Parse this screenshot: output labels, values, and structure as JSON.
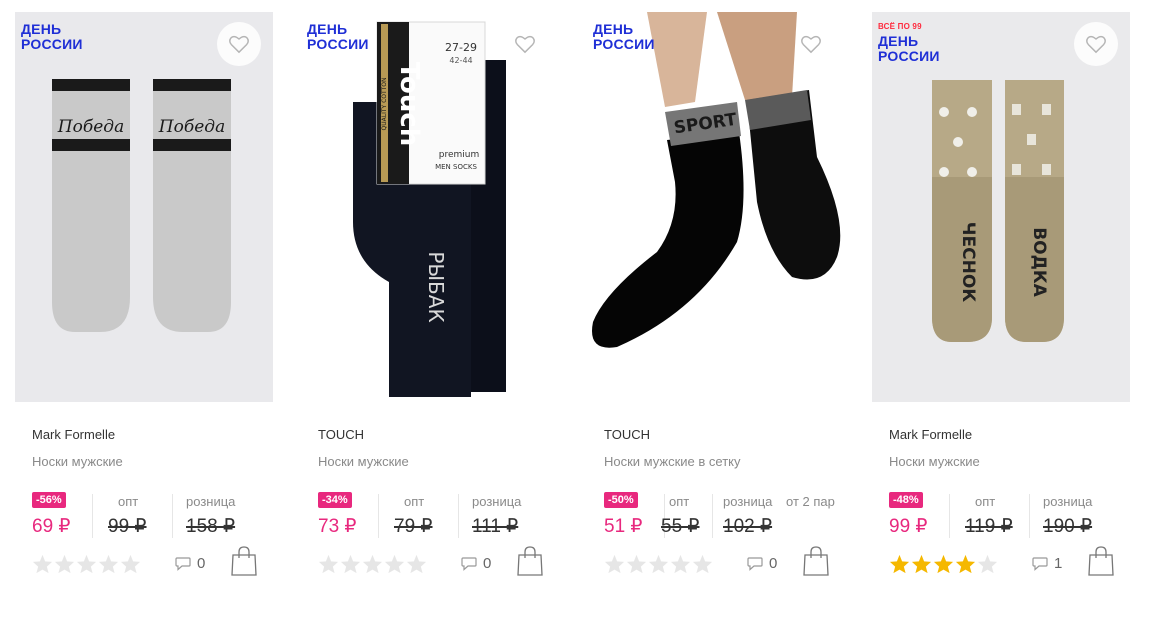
{
  "products": [
    {
      "promo_small": "",
      "promo_line1": "ДЕНЬ",
      "promo_line2": "РОССИИ",
      "brand": "Mark Formelle",
      "title": "Носки мужские",
      "discount": "-56%",
      "price": "69 ₽",
      "label_opt": "опт",
      "opt_price": "99 ₽",
      "label_retail": "розница",
      "retail_price": "158 ₽",
      "label_extra": "",
      "rating": 0,
      "comments": "0",
      "sock_text": "Победа"
    },
    {
      "promo_small": "",
      "promo_line1": "ДЕНЬ",
      "promo_line2": "РОССИИ",
      "brand": "TOUCH",
      "title": "Носки мужские",
      "discount": "-34%",
      "price": "73 ₽",
      "label_opt": "опт",
      "opt_price": "79 ₽",
      "label_retail": "розница",
      "retail_price": "111 ₽",
      "label_extra": "",
      "rating": 0,
      "comments": "0",
      "sock_text": "РЫБАК",
      "pack_brand": "Touch",
      "pack_quality": "QUALITY COTTON",
      "pack_size1": "27-29",
      "pack_size2": "42-44",
      "pack_premium": "premium",
      "pack_men": "MEN SOCKS"
    },
    {
      "promo_small": "",
      "promo_line1": "ДЕНЬ",
      "promo_line2": "РОССИИ",
      "brand": "TOUCH",
      "title": "Носки мужские в сетку",
      "discount": "-50%",
      "price": "51 ₽",
      "label_opt": "опт",
      "opt_price": "55 ₽",
      "label_retail": "розница",
      "retail_price": "102 ₽",
      "label_extra": "от 2 пар",
      "rating": 0,
      "comments": "0",
      "sock_text": "SPORT"
    },
    {
      "promo_small": "ВСЁ ПО 99",
      "promo_line1": "ДЕНЬ",
      "promo_line2": "РОССИИ",
      "brand": "Mark Formelle",
      "title": "Носки мужские",
      "discount": "-48%",
      "price": "99 ₽",
      "label_opt": "опт",
      "opt_price": "119 ₽",
      "label_retail": "розница",
      "retail_price": "190 ₽",
      "label_extra": "",
      "rating": 4,
      "comments": "1",
      "sock_text_left": "ЧЕСНОК",
      "sock_text_right": "ВОДКА"
    }
  ],
  "colors": {
    "accent": "#e8287e",
    "promo": "#1f2fd6",
    "promo_small": "#ff2a3d",
    "star_on": "#f5b800",
    "star_off": "#e6e6e6"
  },
  "icons": {
    "favorite": "heart-outline-icon",
    "comments": "speech-bubble-icon",
    "cart": "shopping-bag-icon",
    "rating": "star-icon"
  }
}
